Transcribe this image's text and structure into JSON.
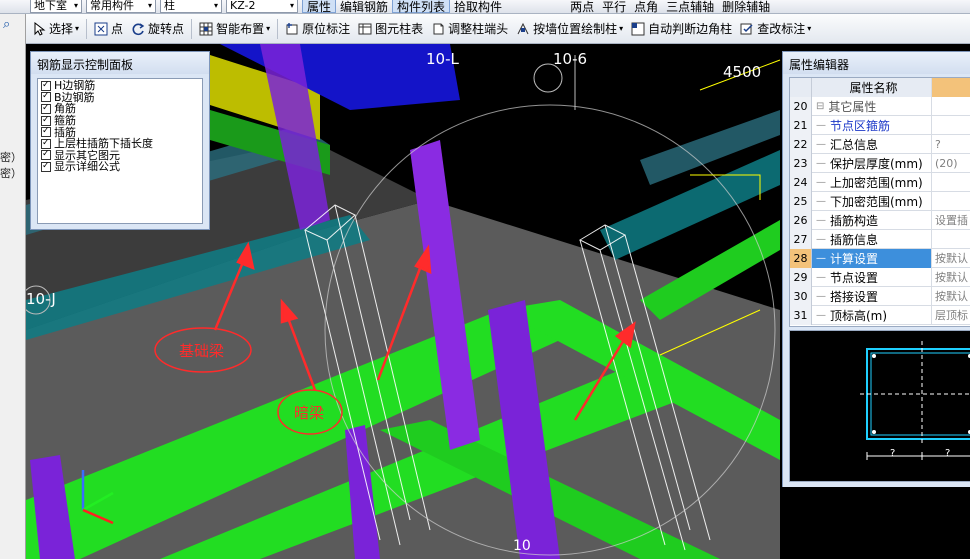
{
  "toolbar1": {
    "floor": "地下室",
    "category": "常用构件",
    "type": "柱",
    "element": "KZ-2",
    "btn_props": "属性",
    "btn_edit_rebar": "编辑钢筋",
    "btn_list": "构件列表",
    "btn_pick": "拾取构件",
    "btn_two_points": "两点",
    "btn_parallel": "平行",
    "btn_point_angle": "点角",
    "btn_three_points": "三点辅轴",
    "btn_delete_aux": "删除辅轴"
  },
  "toolbar2": {
    "select": "选择",
    "point": "点",
    "rotate_point": "旋转点",
    "smart_layout": "智能布置",
    "orig_annotate": "原位标注",
    "element_table": "图元柱表",
    "adjust_head": "调整柱端头",
    "by_wall": "按墙位置绘制柱",
    "auto_corner": "自动判断边角柱",
    "check_annot": "查改标注"
  },
  "left_strip": {
    "line1": "密）",
    "line2": "密）"
  },
  "viewport": {
    "axis_10l": "10-L",
    "axis_106": "10-6",
    "axis_10j": "10-J",
    "dim_4500": "4500",
    "axis_bottom": "10",
    "label_foundation_beam": "基础梁",
    "label_hidden_beam": "暗梁",
    "colors": {
      "beam_green": "#22dd22",
      "column_purple": "#8a2be2",
      "annot_red": "#ff2b2b",
      "slab_gray": "#5b5b5b"
    }
  },
  "rebar_panel": {
    "title": "钢筋显示控制面板",
    "items": [
      {
        "label": "H边钢筋",
        "checked": true
      },
      {
        "label": "B边钢筋",
        "checked": true
      },
      {
        "label": "角筋",
        "checked": true
      },
      {
        "label": "箍筋",
        "checked": true
      },
      {
        "label": "插筋",
        "checked": true
      },
      {
        "label": "上层柱插筋下插长度",
        "checked": true
      },
      {
        "label": "显示其它图元",
        "checked": true
      },
      {
        "label": "显示详细公式",
        "checked": true
      }
    ]
  },
  "props": {
    "title": "属性编辑器",
    "header": {
      "num": "",
      "name": "属性名称",
      "value": ""
    },
    "rows": [
      {
        "num": "20",
        "tree": "⊟",
        "name": "其它属性",
        "value": ""
      },
      {
        "num": "21",
        "tree": "—",
        "name": "节点区箍筋",
        "value": ""
      },
      {
        "num": "22",
        "tree": "—",
        "name": "汇总信息",
        "value": "?"
      },
      {
        "num": "23",
        "tree": "—",
        "name": "保护层厚度(mm)",
        "value": "(20)"
      },
      {
        "num": "24",
        "tree": "—",
        "name": "上加密范围(mm)",
        "value": ""
      },
      {
        "num": "25",
        "tree": "—",
        "name": "下加密范围(mm)",
        "value": ""
      },
      {
        "num": "26",
        "tree": "—",
        "name": "插筋构造",
        "value": "设置插"
      },
      {
        "num": "27",
        "tree": "—",
        "name": "插筋信息",
        "value": ""
      },
      {
        "num": "28",
        "tree": "—",
        "name": "计算设置",
        "value": "按默认"
      },
      {
        "num": "29",
        "tree": "—",
        "name": "节点设置",
        "value": "按默认"
      },
      {
        "num": "30",
        "tree": "—",
        "name": "搭接设置",
        "value": "按默认"
      },
      {
        "num": "31",
        "tree": "—",
        "name": "顶标高(m)",
        "value": "层顶标"
      }
    ],
    "preview_dims": [
      "?",
      "?"
    ]
  }
}
